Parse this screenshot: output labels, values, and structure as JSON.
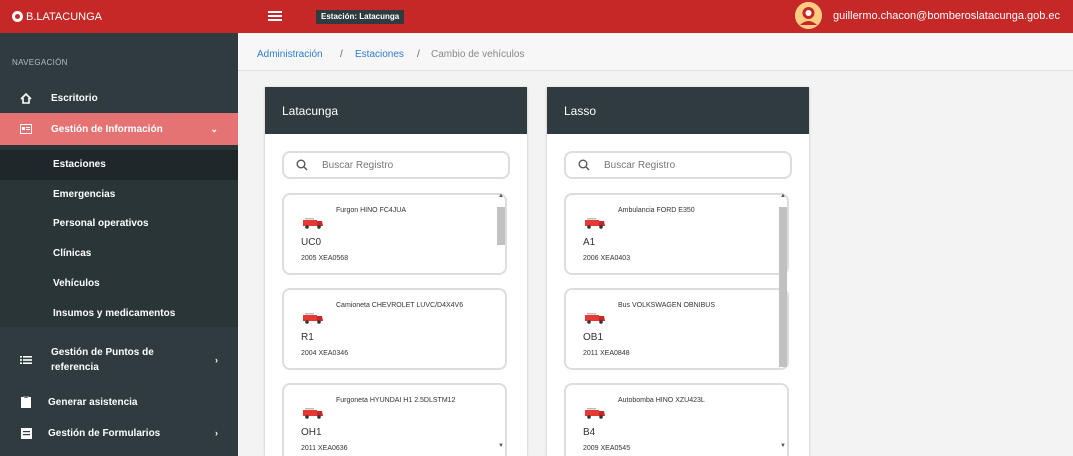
{
  "topbar": {
    "brand": "B.LATACUNGA",
    "station_badge": "Estación: Latacunga",
    "user_email": "guillermo.chacon@bomberoslatacunga.gob.ec",
    "color": "#c62828"
  },
  "sidebar": {
    "header": "NAVEGACIÓN",
    "items": [
      {
        "label": "Escritorio",
        "icon": "home-icon"
      },
      {
        "label": "Gestión de Información",
        "icon": "id-card-icon",
        "active": true
      },
      {
        "label": "Gestión de Puntos de referencia",
        "line1": "Gestión de Puntos de",
        "line2": "referencia",
        "icon": "list-icon"
      },
      {
        "label": "Generar asistencia",
        "icon": "clipboard-icon"
      },
      {
        "label": "Gestión de Formularios",
        "icon": "form-icon"
      }
    ],
    "subitems": [
      "Estaciones",
      "Emergencias",
      "Personal operativos",
      "Clínicas",
      "Vehículos",
      "Insumos y medicamentos"
    ]
  },
  "breadcrumb": [
    "Administración",
    "Estaciones",
    "Cambio de vehículos"
  ],
  "panels": [
    {
      "title": "Latacunga",
      "search_placeholder": "Buscar Registro",
      "vehicles": [
        {
          "title": "Furgon HINO FC4JUA",
          "code": "UC0",
          "sub": "2005 XEA0568"
        },
        {
          "title": "Camioneta CHEVROLET LUVC/D4X4V6",
          "code": "R1",
          "sub": "2004 XEA0346"
        },
        {
          "title": "Furgoneta HYUNDAI H1 2.5DLSTM12",
          "code": "OH1",
          "sub": "2011 XEA0636"
        }
      ]
    },
    {
      "title": "Lasso",
      "search_placeholder": "Buscar Registro",
      "vehicles": [
        {
          "title": "Ambulancia FORD E350",
          "code": "A1",
          "sub": "2006 XEA0403"
        },
        {
          "title": "Bus VOLKSWAGEN OBNIBUS",
          "code": "OB1",
          "sub": "2011 XEA0848"
        },
        {
          "title": "Autobomba HINO XZU423L",
          "code": "B4",
          "sub": "2009 XEA0545"
        }
      ]
    }
  ]
}
